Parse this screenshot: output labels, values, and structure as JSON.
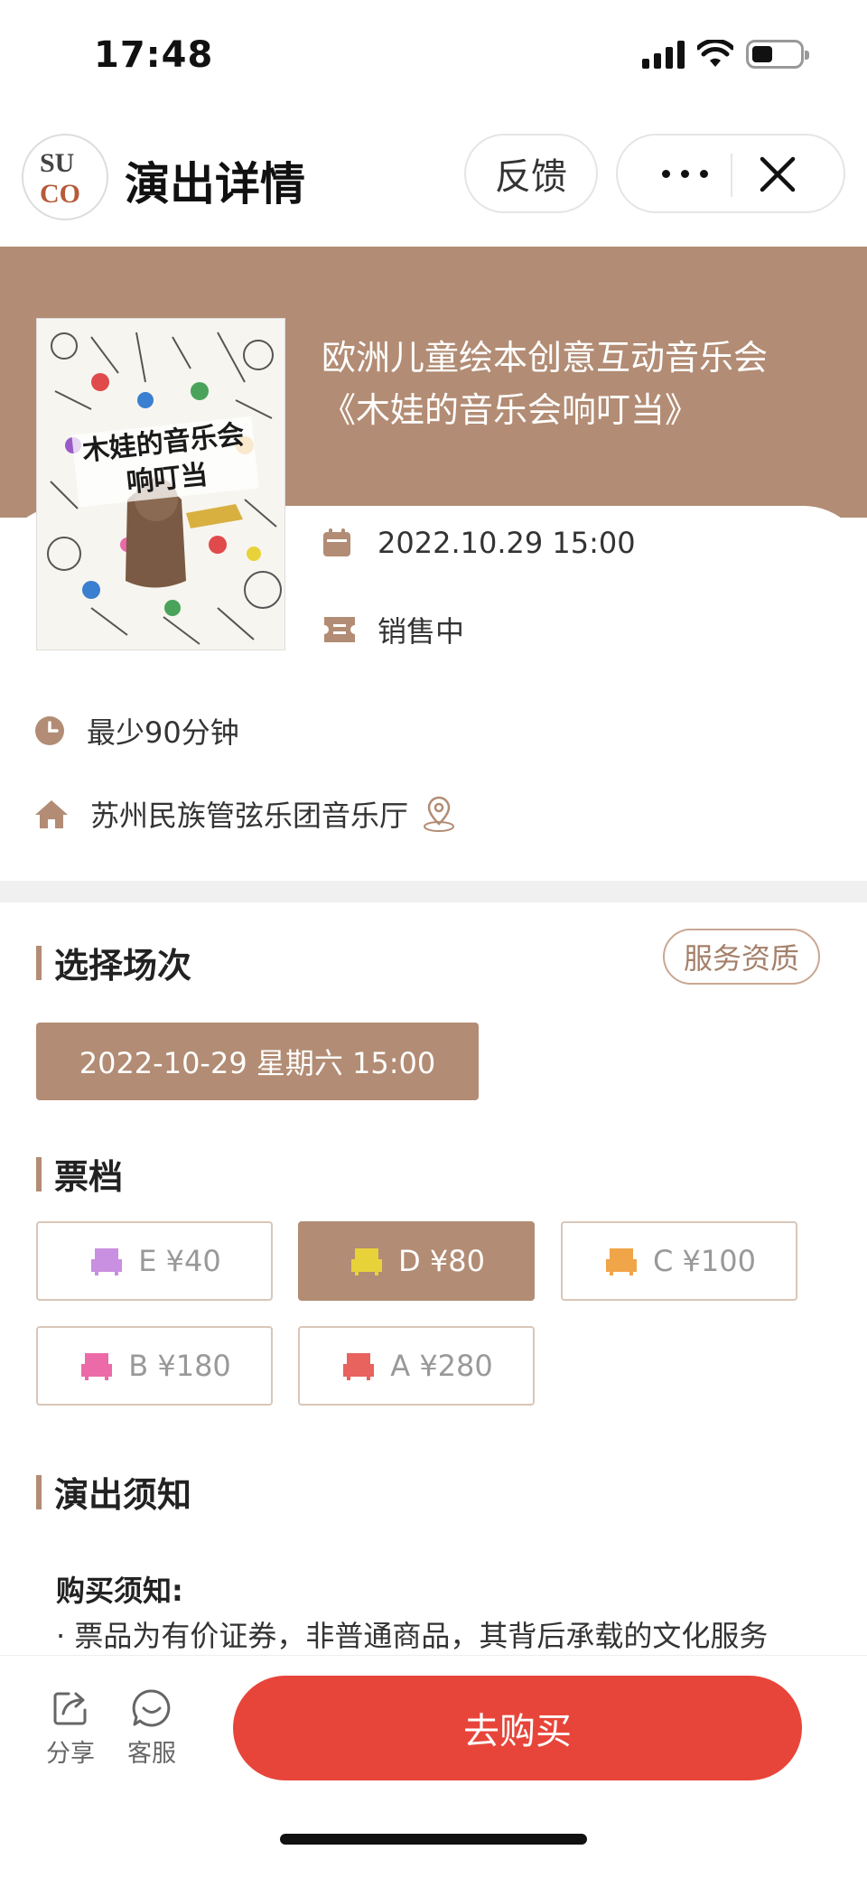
{
  "status_bar": {
    "time": "17:48"
  },
  "nav": {
    "logo_text_top": "SU",
    "logo_text_bottom": "CO",
    "title": "演出详情",
    "feedback_label": "反馈"
  },
  "event": {
    "title_line1": "欧洲儿童绘本创意互动音乐会",
    "title_line2": "《木娃的音乐会响叮当》",
    "poster_text": "木娃的音乐会响叮当",
    "datetime": "2022.10.29 15:00",
    "status": "销售中",
    "duration": "最少90分钟",
    "venue": "苏州民族管弦乐团音乐厅"
  },
  "session_section": {
    "title": "选择场次",
    "service_button": "服务资质",
    "sessions": [
      "2022-10-29 星期六 15:00"
    ]
  },
  "ticket_section": {
    "title": "票档",
    "tiers": [
      {
        "label": "E ¥40",
        "icon_color": "#c98fe0",
        "selected": false
      },
      {
        "label": "D ¥80",
        "icon_color": "#e8d23a",
        "selected": true
      },
      {
        "label": "C ¥100",
        "icon_color": "#f0a548",
        "selected": false
      },
      {
        "label": "B ¥180",
        "icon_color": "#ec6aa8",
        "selected": false
      },
      {
        "label": "A ¥280",
        "icon_color": "#e8625e",
        "selected": false
      }
    ]
  },
  "notice_section": {
    "title": "演出须知",
    "purchase_label": "购买须知:",
    "line1": "· 票品为有价证券，非普通商品，其背后承载的文化服务"
  },
  "bottom_bar": {
    "share_label": "分享",
    "service_label": "客服",
    "buy_label": "去购买"
  },
  "colors": {
    "brand": "#b28c74",
    "buy": "#e8453a",
    "divider": "#f0f0f0"
  }
}
